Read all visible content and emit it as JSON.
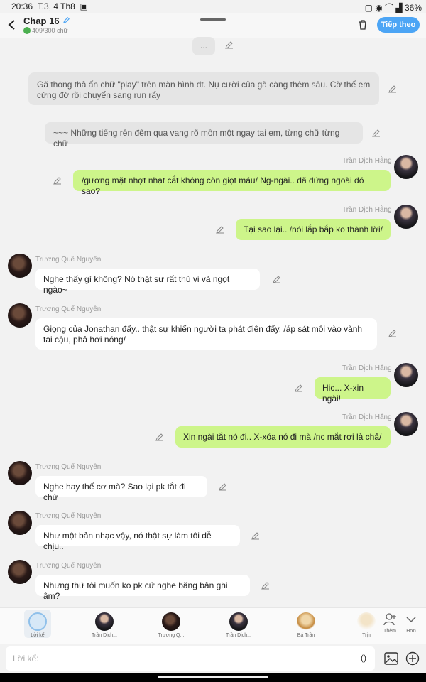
{
  "status": {
    "time": "20:36",
    "date": "T.3, 4 Th8",
    "battery": "36%"
  },
  "header": {
    "title": "Chap 16",
    "word_count": "409/300 chữ",
    "next_label": "Tiếp theo"
  },
  "messages": [
    {
      "type": "narration",
      "text": "..."
    },
    {
      "type": "narration",
      "text": "Gã thong thả ấn chữ \"play\" trên màn hình đt. Nụ cười của gã càng thêm sâu. Cờ thế em cứng đờ rồi chuyển sang run rẩy"
    },
    {
      "type": "narration",
      "text": "~~~ Những tiếng rên đêm qua vang rõ mồn một ngay tai em, từng chữ từng chữ"
    },
    {
      "type": "right",
      "name": "Trần Dịch Hằng",
      "text": "/gương mặt nhợt nhạt cắt không còn giọt máu/ Ng-ngài.. đã đứng ngoài đó sao?"
    },
    {
      "type": "right",
      "name": "Trần Dịch Hằng",
      "text": "Tại sao lại.. /nói lắp bắp ko thành lời/"
    },
    {
      "type": "left",
      "name": "Trương Quế Nguyên",
      "text": "Nghe thấy gì không? Nó thật sự rất thú vị và ngọt ngào~"
    },
    {
      "type": "left",
      "name": "Trương Quế Nguyên",
      "text": "Giọng của Jonathan đấy.. thật sự khiến người ta phát điên đấy. /áp sát môi vào vành tai cậu, phả hơi nóng/"
    },
    {
      "type": "right",
      "name": "Trần Dịch Hằng",
      "text": "Hic... X-xin ngài!"
    },
    {
      "type": "right",
      "name": "Trần Dịch Hằng",
      "text": "Xin ngài tắt nó đi.. X-xóa nó đi mà /nc mắt rơi lả chả/"
    },
    {
      "type": "left",
      "name": "Trương Quế Nguyên",
      "text": "Nghe hay thế cơ mà? Sao lại pk tắt đi chứ"
    },
    {
      "type": "left",
      "name": "Trương Quế Nguyên",
      "text": "Như một bản nhạc vậy, nó thật sự làm tôi dễ chịu.."
    },
    {
      "type": "left",
      "name": "Trương Quế Nguyên",
      "text": "Nhưng thứ tôi muốn ko pk cứ nghe băng bản ghi âm?"
    }
  ],
  "characters": [
    {
      "label": "Lời kể",
      "active": true
    },
    {
      "label": "Trần Dịch..."
    },
    {
      "label": "Trương Q..."
    },
    {
      "label": "Trần Dịch..."
    },
    {
      "label": "Bá Trần"
    },
    {
      "label": "Trịn"
    }
  ],
  "actions": {
    "add_label": "Thêm",
    "more_label": "Hơn"
  },
  "input": {
    "placeholder": "Lời kể:",
    "paren": "()"
  },
  "colors": {
    "accent": "#4ca5f5",
    "bubble_right": "#cdf58a",
    "bubble_left": "#ffffff",
    "narration": "#e5e5e5"
  }
}
